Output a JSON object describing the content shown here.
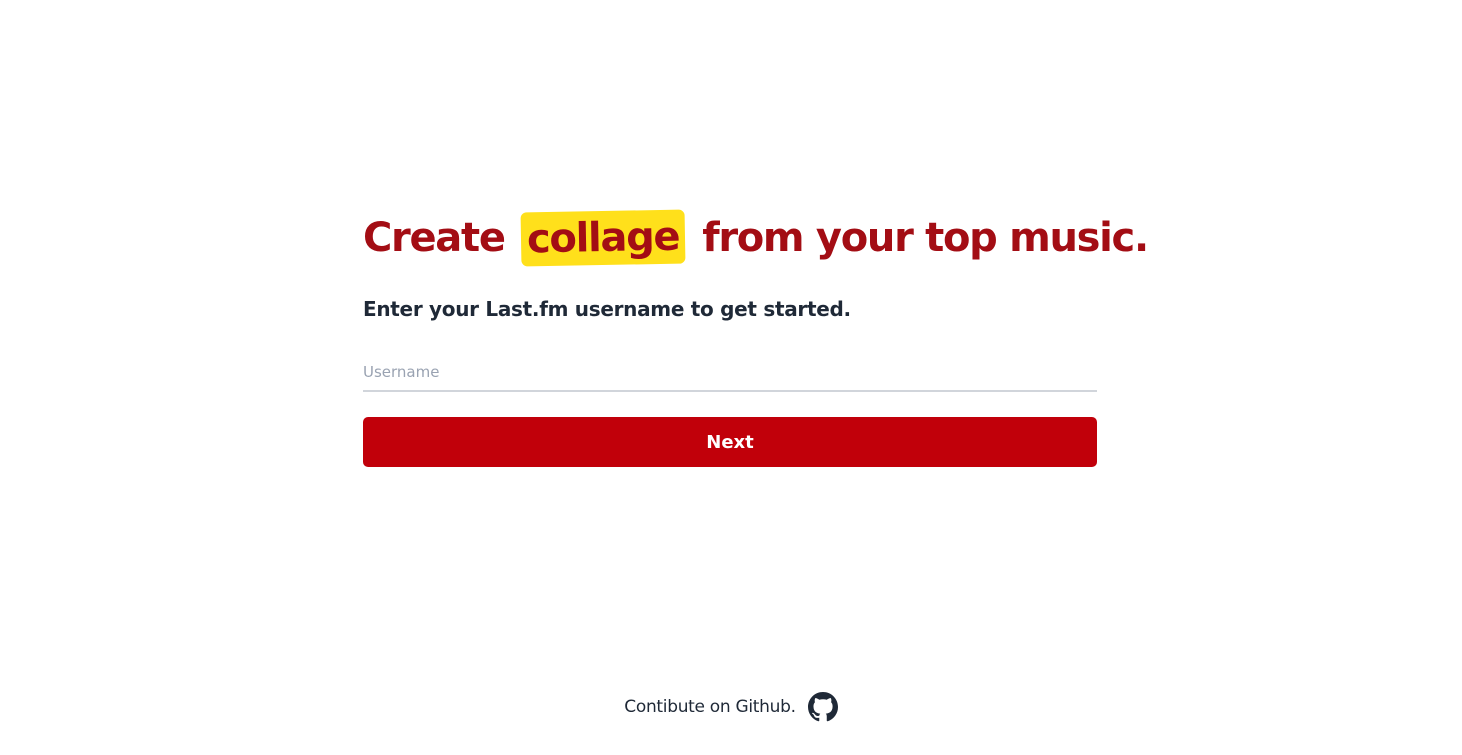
{
  "hero": {
    "title_before": "Create",
    "title_highlight": "collage",
    "title_after": "from your top music.",
    "subtitle": "Enter your Last.fm username to get started."
  },
  "form": {
    "username_placeholder": "Username",
    "username_value": "",
    "next_label": "Next"
  },
  "footer": {
    "text": "Contibute on Github.",
    "icon": "github-icon"
  },
  "colors": {
    "brand_red": "#c1000a",
    "title_red": "#a30d14",
    "highlight_yellow": "#ffe01b",
    "text_dark": "#1f2937"
  }
}
